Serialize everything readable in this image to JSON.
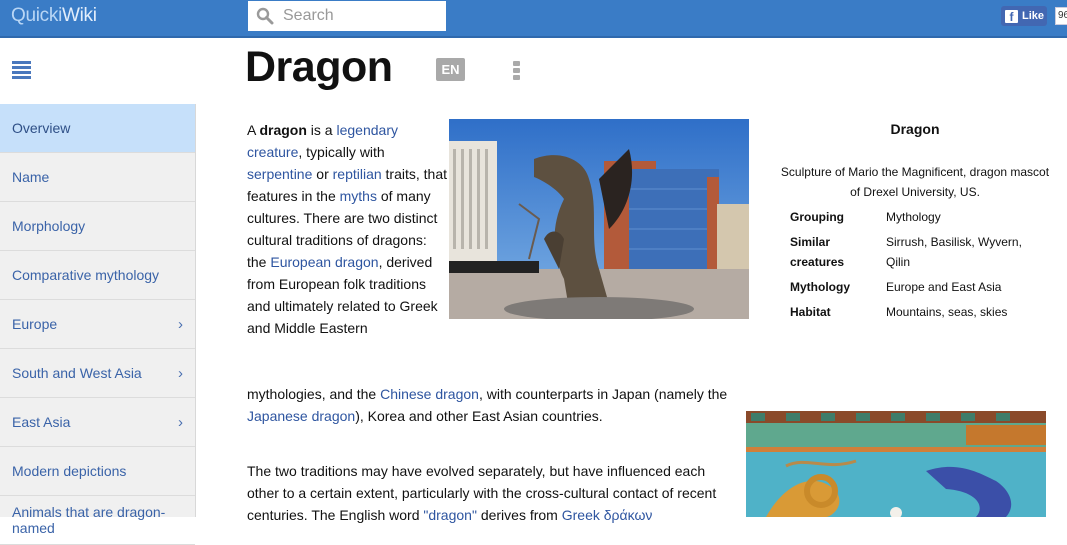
{
  "header": {
    "brand_part1": "Quicki",
    "brand_part2": "Wiki",
    "search_placeholder": "Search",
    "search_value": "",
    "facebook_like_label": "Like",
    "facebook_like_count": "96",
    "colors": {
      "topbar": "#3a7cc6",
      "link": "#2e55a0",
      "sidebar_active": "#c6e0fa"
    }
  },
  "page": {
    "title": "Dragon",
    "language": "EN",
    "menu_icon": "hamburger-menu-icon",
    "more_icon": "vertical-dots-icon"
  },
  "sidebar": {
    "items": [
      {
        "label": "Overview",
        "active": true,
        "has_children": false
      },
      {
        "label": "Name",
        "active": false,
        "has_children": false
      },
      {
        "label": "Morphology",
        "active": false,
        "has_children": false
      },
      {
        "label": "Comparative mythology",
        "active": false,
        "has_children": false
      },
      {
        "label": "Europe",
        "active": false,
        "has_children": true
      },
      {
        "label": "South and West Asia",
        "active": false,
        "has_children": true
      },
      {
        "label": "East Asia",
        "active": false,
        "has_children": true
      },
      {
        "label": "Modern depictions",
        "active": false,
        "has_children": false
      },
      {
        "label": "Animals that are dragon-named",
        "active": false,
        "has_children": false
      }
    ],
    "chevron": "›"
  },
  "article": {
    "p1": {
      "t1": "A ",
      "bold": "dragon",
      "t2": " is a ",
      "l1": "legendary creature",
      "t3": ", typically with ",
      "l2": "serpentine",
      "t4": " or ",
      "l3": "reptilian",
      "t5": " traits, that features in the ",
      "l4": "myths",
      "t6": " of many cultures. There are two distinct cultural traditions of dragons: the ",
      "l5": "European dragon",
      "t7": ", derived from European folk traditions and ultimately related to Greek and Middle Eastern",
      "t8": "mythologies, and the ",
      "l6": "Chinese dragon",
      "t9": ", with counterparts in Japan (namely the ",
      "l7": "Japanese dragon",
      "t10": "), Korea and other East Asian countries."
    },
    "p2": {
      "t1": "The two traditions may have evolved separately, but have influenced each other to a certain extent, particularly with the cross-cultural contact of recent centuries. The English word ",
      "l1": "\"dragon\"",
      "t2": " derives from ",
      "l2": "Greek δράκων"
    },
    "image1_alt": "Bronze dragon sculpture on a city plaza",
    "image2_alt": "Nine-dragon wall ceramic relief"
  },
  "infobox": {
    "title": "Dragon",
    "caption": "Sculpture of Mario the Magnificent, dragon mascot of Drexel University, US.",
    "rows": [
      {
        "key": "Grouping",
        "value": "Mythology"
      },
      {
        "key": "Similar creatures",
        "value": "Sirrush, Basilisk, Wyvern, Qilin"
      },
      {
        "key": "Mythology",
        "value": "Europe and East Asia"
      },
      {
        "key": "Habitat",
        "value": "Mountains, seas, skies"
      }
    ]
  }
}
